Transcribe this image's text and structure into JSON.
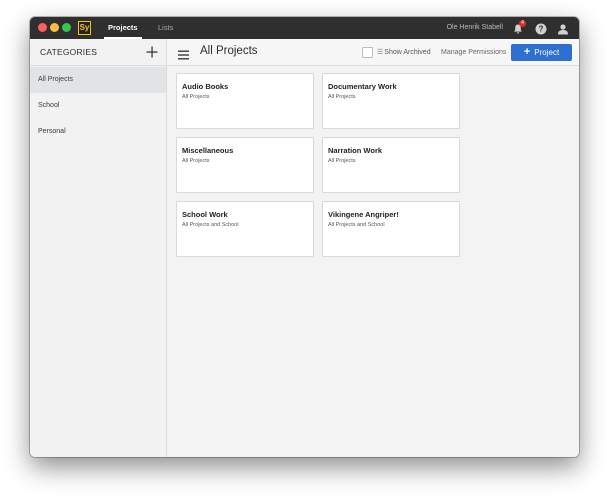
{
  "titlebar": {
    "app_logo": "Sy",
    "tabs": [
      {
        "label": "Projects",
        "active": true
      },
      {
        "label": "Lists",
        "active": false
      }
    ],
    "user_name": "Ole Henrik Stabell",
    "notification_count": "4",
    "icons": [
      "bell-icon",
      "help-icon",
      "user-icon"
    ]
  },
  "sidebar": {
    "title": "CATEGORIES",
    "add_icon": "plus-icon",
    "items": [
      {
        "label": "All Projects",
        "selected": true
      },
      {
        "label": "School",
        "selected": false
      },
      {
        "label": "Personal",
        "selected": false
      }
    ]
  },
  "toolbar": {
    "menu_icon": "hamburger-icon",
    "title": "All Projects",
    "show_archived_label": "Show Archived",
    "manage_permissions_label": "Manage Permissions",
    "new_project_label": "Project"
  },
  "projects": [
    {
      "title": "Audio Books",
      "category": "All Projects"
    },
    {
      "title": "Documentary Work",
      "category": "All Projects"
    },
    {
      "title": "Miscellaneous",
      "category": "All Projects"
    },
    {
      "title": "Narration Work",
      "category": "All Projects"
    },
    {
      "title": "School Work",
      "category": "All Projects and School"
    },
    {
      "title": "Vikingene Angriper!",
      "category": "All Projects and School"
    }
  ],
  "colors": {
    "titlebar_bg": "#2f2f2f",
    "accent_blue": "#2d70d2",
    "sidebar_selected": "#e1e3e6",
    "badge_red": "#e02b2b"
  }
}
